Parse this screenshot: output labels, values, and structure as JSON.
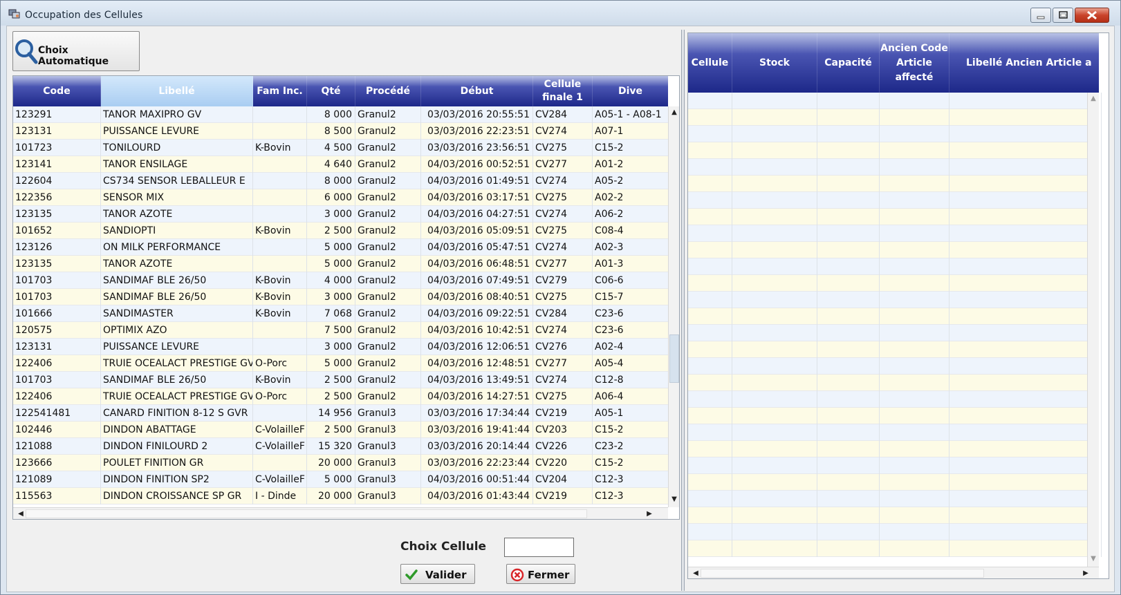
{
  "window": {
    "title": "Occupation des Cellules"
  },
  "toolbar": {
    "auto_label": "Choix Automatique"
  },
  "left_grid": {
    "columns": [
      {
        "key": "code",
        "label": "Code",
        "w": 127,
        "align": "left"
      },
      {
        "key": "libelle",
        "label": "Libellé",
        "w": 220,
        "align": "left",
        "selected": true
      },
      {
        "key": "fam",
        "label": "Fam Inc.",
        "w": 78,
        "align": "left"
      },
      {
        "key": "qte",
        "label": "Qté",
        "w": 70,
        "align": "right"
      },
      {
        "key": "procede",
        "label": "Procédé",
        "w": 95,
        "align": "left"
      },
      {
        "key": "debut",
        "label": "Début",
        "w": 162,
        "align": "right"
      },
      {
        "key": "cellule",
        "label": "Cellule finale 1",
        "w": 86,
        "align": "left"
      },
      {
        "key": "divers",
        "label": "Dive",
        "w": 110,
        "align": "left"
      }
    ],
    "rows": [
      [
        "123291",
        "TANOR MAXIPRO GV",
        "",
        "8 000",
        "Granul2",
        "03/03/2016 20:55:51",
        "CV284",
        "A05-1 - A08-1"
      ],
      [
        "123131",
        "PUISSANCE LEVURE",
        "",
        "8 500",
        "Granul2",
        "03/03/2016 22:23:51",
        "CV274",
        "A07-1"
      ],
      [
        "101723",
        "TONILOURD",
        "K-Bovin",
        "4 500",
        "Granul2",
        "03/03/2016 23:56:51",
        "CV275",
        "C15-2"
      ],
      [
        "123141",
        "TANOR ENSILAGE",
        "",
        "4 640",
        "Granul2",
        "04/03/2016 00:52:51",
        "CV277",
        "A01-2"
      ],
      [
        "122604",
        "CS734 SENSOR LEBALLEUR E",
        "",
        "8 000",
        "Granul2",
        "04/03/2016 01:49:51",
        "CV274",
        "A05-2"
      ],
      [
        "122356",
        "SENSOR MIX",
        "",
        "6 000",
        "Granul2",
        "04/03/2016 03:17:51",
        "CV275",
        "A02-2"
      ],
      [
        "123135",
        "TANOR AZOTE",
        "",
        "3 000",
        "Granul2",
        "04/03/2016 04:27:51",
        "CV274",
        "A06-2"
      ],
      [
        "101652",
        "SANDIOPTI",
        "K-Bovin",
        "2 500",
        "Granul2",
        "04/03/2016 05:09:51",
        "CV275",
        "C08-4"
      ],
      [
        "123126",
        "ON MILK PERFORMANCE",
        "",
        "5 000",
        "Granul2",
        "04/03/2016 05:47:51",
        "CV274",
        "A02-3"
      ],
      [
        "123135",
        "TANOR AZOTE",
        "",
        "5 000",
        "Granul2",
        "04/03/2016 06:48:51",
        "CV277",
        "A01-3"
      ],
      [
        "101703",
        "SANDIMAF BLE 26/50",
        "K-Bovin",
        "4 000",
        "Granul2",
        "04/03/2016 07:49:51",
        "CV279",
        "C06-6"
      ],
      [
        "101703",
        "SANDIMAF BLE 26/50",
        "K-Bovin",
        "3 000",
        "Granul2",
        "04/03/2016 08:40:51",
        "CV275",
        "C15-7"
      ],
      [
        "101666",
        "SANDIMASTER",
        "K-Bovin",
        "7 068",
        "Granul2",
        "04/03/2016 09:22:51",
        "CV284",
        "C23-6"
      ],
      [
        "120575",
        "OPTIMIX AZO",
        "",
        "7 500",
        "Granul2",
        "04/03/2016 10:42:51",
        "CV274",
        "C23-6"
      ],
      [
        "123131",
        "PUISSANCE LEVURE",
        "",
        "3 000",
        "Granul2",
        "04/03/2016 12:06:51",
        "CV276",
        "A02-4"
      ],
      [
        "122406",
        "TRUIE OCEALACT PRESTIGE GV",
        "O-Porc",
        "5 000",
        "Granul2",
        "04/03/2016 12:48:51",
        "CV277",
        "A05-4"
      ],
      [
        "101703",
        "SANDIMAF BLE 26/50",
        "K-Bovin",
        "2 500",
        "Granul2",
        "04/03/2016 13:49:51",
        "CV274",
        "C12-8"
      ],
      [
        "122406",
        "TRUIE OCEALACT PRESTIGE GV",
        "O-Porc",
        "2 500",
        "Granul2",
        "04/03/2016 14:27:51",
        "CV275",
        "A06-4"
      ],
      [
        "122541481",
        "CANARD FINITION 8-12 S GVR",
        "",
        "14 956",
        "Granul3",
        "03/03/2016 17:34:44",
        "CV219",
        "A05-1"
      ],
      [
        "102446",
        "DINDON ABATTAGE",
        "C-VolailleF",
        "2 500",
        "Granul3",
        "03/03/2016 19:41:44",
        "CV203",
        "C15-2"
      ],
      [
        "121088",
        "DINDON FINILOURD 2",
        "C-VolailleF",
        "15 320",
        "Granul3",
        "03/03/2016 20:14:44",
        "CV226",
        "C23-2"
      ],
      [
        "123666",
        "POULET FINITION GR",
        "",
        "20 000",
        "Granul3",
        "03/03/2016 22:23:44",
        "CV220",
        "C15-2"
      ],
      [
        "121089",
        "DINDON FINITION SP2",
        "C-VolailleF",
        "5 000",
        "Granul3",
        "04/03/2016 00:51:44",
        "CV204",
        "C12-3"
      ],
      [
        "115563",
        "DINDON CROISSANCE SP GR",
        "I - Dinde",
        "20 000",
        "Granul3",
        "04/03/2016 01:43:44",
        "CV219",
        "C12-3"
      ]
    ]
  },
  "right_grid": {
    "columns": [
      {
        "key": "cellule",
        "label": "Cellule",
        "w": 64
      },
      {
        "key": "stock",
        "label": "Stock",
        "w": 123
      },
      {
        "key": "capacite",
        "label": "Capacité",
        "w": 90
      },
      {
        "key": "ancien_code",
        "label": "Ancien Code Article affecté",
        "w": 101
      },
      {
        "key": "libelle_ancien",
        "label": "Libellé Ancien Article a",
        "w": 220
      }
    ],
    "empty_rows": 28
  },
  "footer": {
    "choix_cellule_label": "Choix Cellule",
    "choix_cellule_value": "",
    "valider_label": "Valider",
    "fermer_label": "Fermer"
  }
}
